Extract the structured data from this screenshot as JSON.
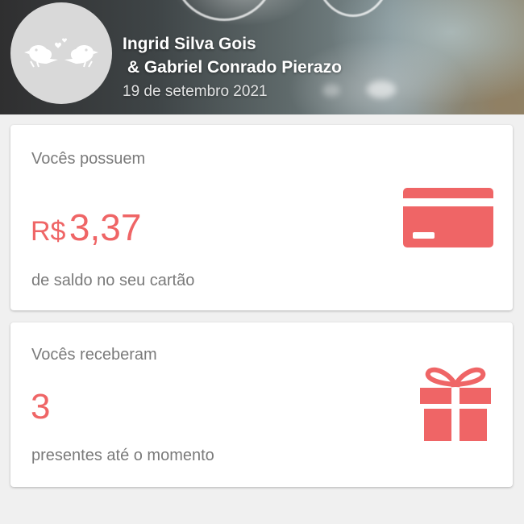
{
  "header": {
    "couple_line1": "Ingrid Silva Gois",
    "couple_line2": " & Gabriel Conrado Pierazo",
    "date": "19 de setembro 2021",
    "avatar_icon": "lovebirds-icon"
  },
  "balance_card": {
    "label": "Vocês possuem",
    "currency": "R$",
    "value": "3,37",
    "subtitle": "de saldo no seu cartão",
    "icon": "credit-card-icon"
  },
  "gifts_card": {
    "label": "Vocês receberam",
    "count": "3",
    "subtitle": "presentes até o momento",
    "icon": "gift-icon"
  },
  "colors": {
    "accent": "#ef6566",
    "label_gray": "#7a7a7a",
    "background": "#f0f0f0",
    "avatar_bg": "#d9d9d9"
  }
}
